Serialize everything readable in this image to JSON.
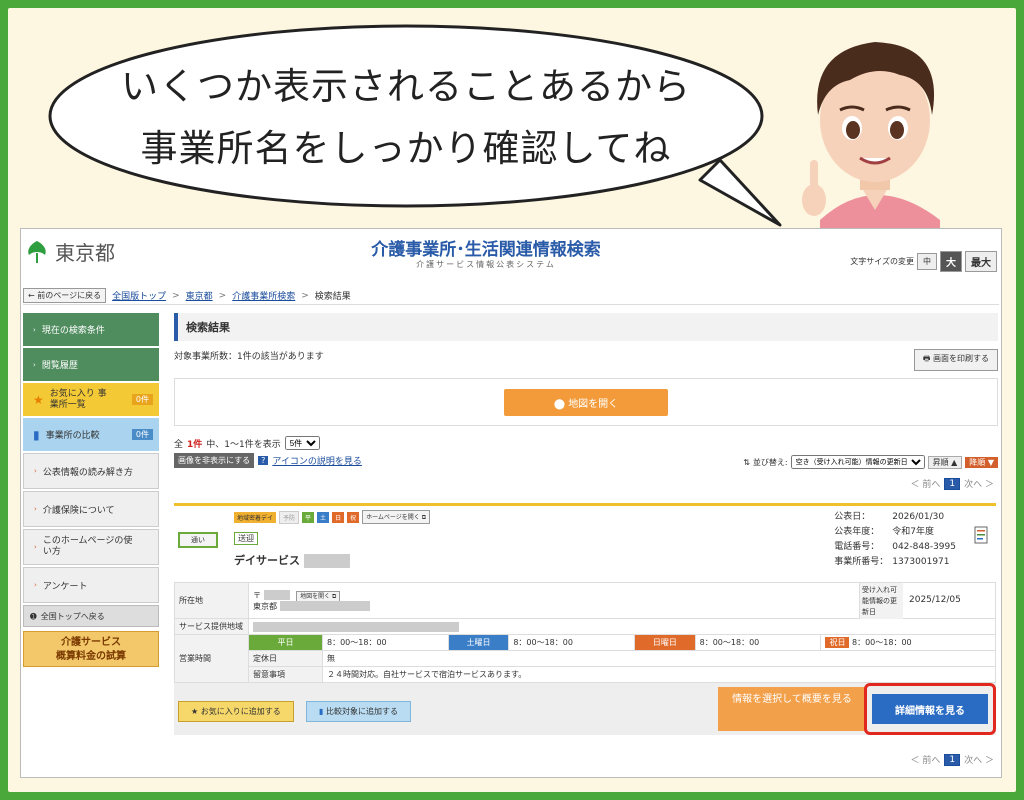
{
  "bubble": {
    "line1": "いくつか表示されることあるから",
    "line2": "事業所名をしっかり確認してね"
  },
  "header": {
    "logo_text": "東京都",
    "title": "介護事業所･生活関連情報検索",
    "subtitle": "介護サービス情報公表システム",
    "font_size_label": "文字サイズの変更",
    "font_sizes": [
      "中",
      "大",
      "最大"
    ]
  },
  "breadcrumb": {
    "back": "前のページに戻る",
    "items": [
      "全国版トップ",
      "東京都",
      "介護事業所検索",
      "検索結果"
    ],
    "separator": ">"
  },
  "sidebar": {
    "current_conditions": "現在の検索条件",
    "history": "閲覧履歴",
    "favorites_label": "お気に入り 事業所一覧",
    "favorites_count": "0件",
    "compare_label": "事業所の比較",
    "compare_count": "0件",
    "read_guide": "公表情報の読み解き方",
    "about_insurance": "介護保険について",
    "how_to_use": "このホームページの使い方",
    "survey": "アンケート",
    "back_top": "全国トップへ戻る",
    "calc_line1": "介護サービス",
    "calc_line2": "概算料金の試算"
  },
  "main": {
    "section_title": "検索結果",
    "count_text": "対象事業所数：1件の該当があります",
    "print_button": "画面を印刷する",
    "map_button": "地図を開く",
    "paging_prefix": "全",
    "paging_count": "1件",
    "paging_suffix": "中、1〜1件を表示",
    "per_page": "5件",
    "hide_images": "画像を非表示にする",
    "icon_help": "アイコンの説明を見る",
    "sort_label": "並び替え:",
    "sort_value": "空き（受け入れ可能）情報の更新日",
    "sort_asc": "昇順",
    "sort_desc": "降順",
    "prev": "＜ 前へ",
    "next": "次へ ＞",
    "current_page": "1"
  },
  "facility": {
    "tags": [
      "地域密着デイ",
      "予防",
      "平",
      "土",
      "日",
      "祝"
    ],
    "homepage_btn": "ホームページを開く",
    "kayoi": "通い",
    "sougei": "送迎",
    "name": "デイサービス",
    "info": [
      {
        "k": "公表日：",
        "v": "2026/01/30"
      },
      {
        "k": "公表年度：",
        "v": "令和7年度"
      },
      {
        "k": "電話番号：",
        "v": "042-848-3995"
      },
      {
        "k": "事業所番号：",
        "v": "1373001971"
      }
    ],
    "address_label": "所在地",
    "postal_prefix": "〒",
    "address_prefix": "東京都",
    "map_small": "地図を開く",
    "accept_label": "受け入れ可能情報の更新日",
    "accept_date": "2025/12/05",
    "area_label": "サービス提供地域",
    "hours_label": "営業時間",
    "weekday": "平日",
    "weekday_time": "8：00〜18：00",
    "saturday": "土曜日",
    "saturday_time": "8：00〜18：00",
    "sunday": "日曜日",
    "sunday_time": "8：00〜18：00",
    "holiday": "祝日",
    "holiday_time": "8：00〜18：00",
    "closed_label": "定休日",
    "closed_value": "無",
    "notes_label": "留意事項",
    "notes_value": "２４時間対応。自社サービスで宿泊サービスあります。",
    "fav_button": "お気に入りに追加する",
    "compare_button": "比較対象に追加する",
    "select_button": "情報を選択して概要を見る",
    "detail_button": "詳細情報を見る"
  }
}
